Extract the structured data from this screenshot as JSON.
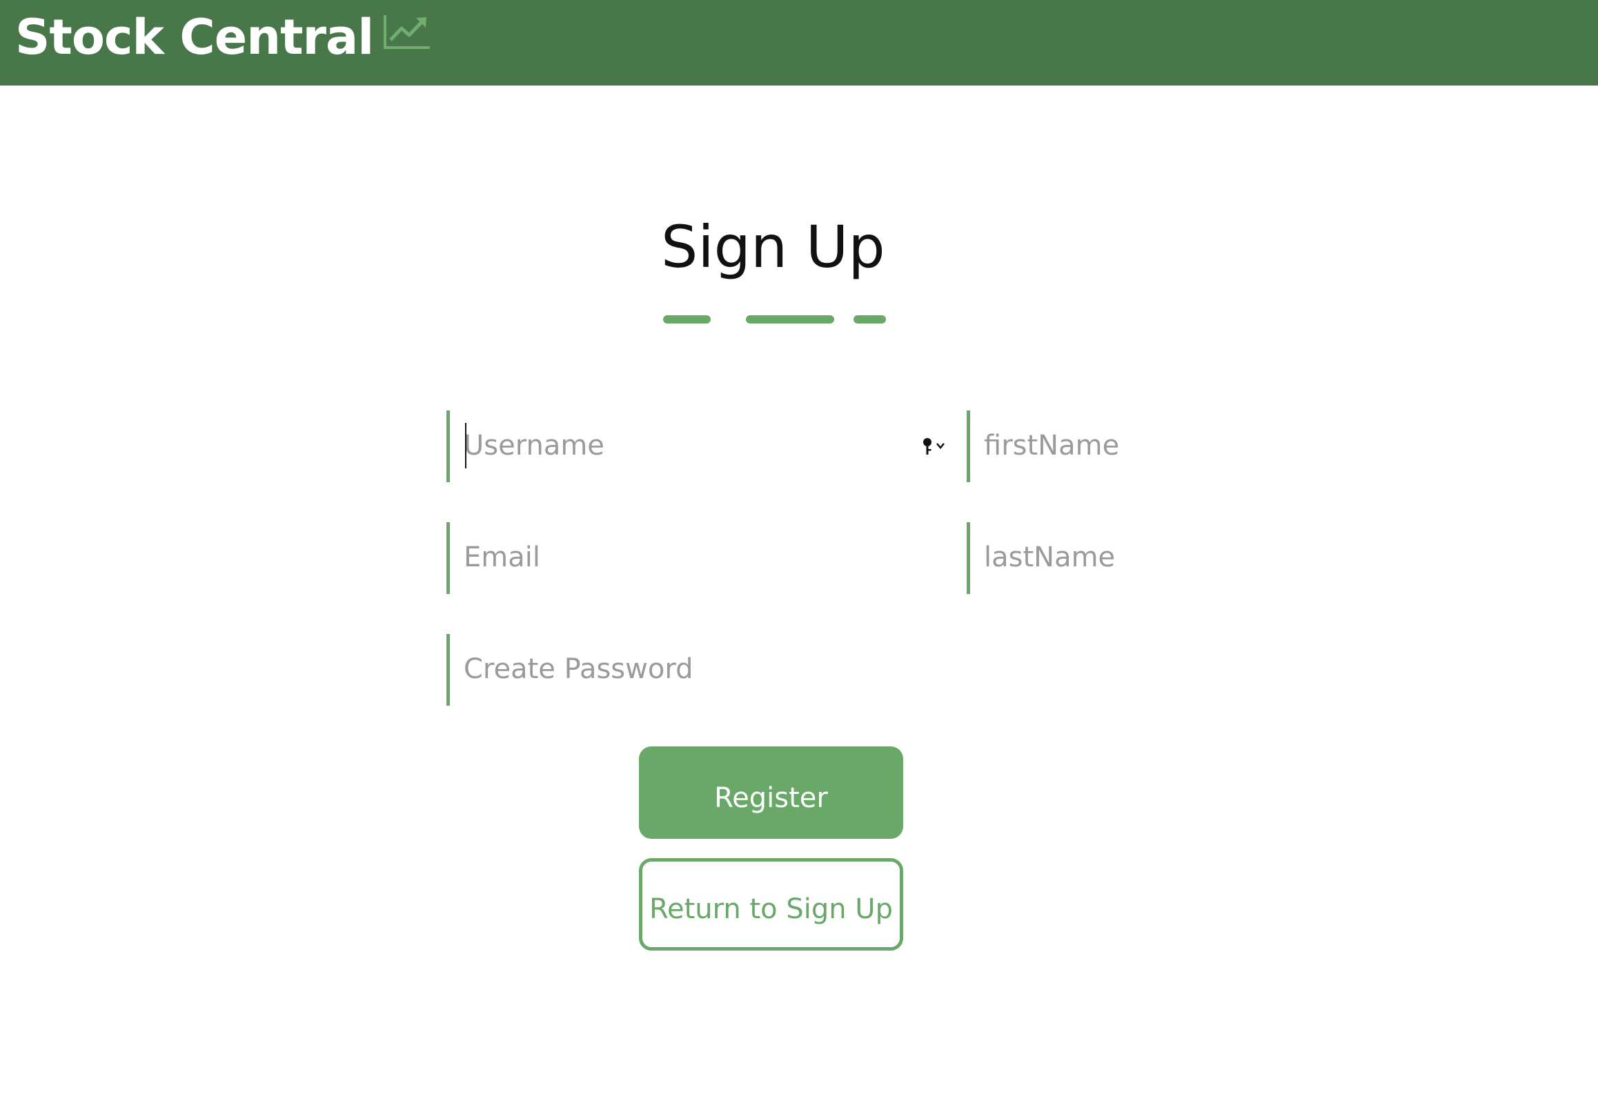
{
  "header": {
    "app_name": "Stock Central",
    "logo_icon": "trending-chart-icon",
    "background_color": "#48774a"
  },
  "form": {
    "title": "Sign Up",
    "accent_color": "#69a869",
    "fields": {
      "username": {
        "placeholder": "Username",
        "value": ""
      },
      "first_name": {
        "placeholder": "firstName",
        "value": ""
      },
      "email": {
        "placeholder": "Email",
        "value": ""
      },
      "last_name": {
        "placeholder": "lastName",
        "value": ""
      },
      "password": {
        "placeholder": "Create Password",
        "value": ""
      }
    },
    "register_label": "Register",
    "return_label": "Return to Sign Up"
  },
  "icons": {
    "password_manager": "key-icon"
  }
}
